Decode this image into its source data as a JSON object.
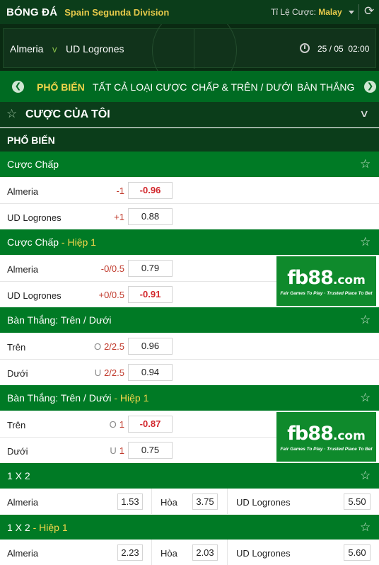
{
  "topbar": {
    "sport": "BÓNG ĐÁ",
    "league": "Spain Segunda Division",
    "odds_type_label": "Tỉ Lệ Cược:",
    "odds_type_value": "Malay",
    "refresh_icon": "refresh-icon"
  },
  "match": {
    "home": "Almeria",
    "vs": "v",
    "away": "UD Logrones",
    "kickoff": "25 / 05  02:00",
    "clock_icon": "clock-icon"
  },
  "tabs": [
    {
      "label": "PHỔ BIẾN",
      "active": true
    },
    {
      "label": "TẤT CẢ LOẠI CƯỢC",
      "active": false
    },
    {
      "label": "CHẤP & TRÊN / DƯỚI",
      "active": false
    },
    {
      "label": "BÀN THẮNG",
      "active": false
    }
  ],
  "my_bets": {
    "title": "CƯỢC CỦA TÔI"
  },
  "popular": {
    "title": "PHỔ BIẾN"
  },
  "markets": {
    "handicap": {
      "name": "Cược Chấp",
      "rows": [
        {
          "team": "Almeria",
          "line": "-1",
          "odd": "-0.96"
        },
        {
          "team": "UD Logrones",
          "line": "+1",
          "odd": "0.88"
        }
      ]
    },
    "handicap_h1": {
      "name": "Cược Chấp",
      "suffix": " - Hiệp 1",
      "rows": [
        {
          "team": "Almeria",
          "line": "-0/0.5",
          "odd": "0.79"
        },
        {
          "team": "UD Logrones",
          "line": "+0/0.5",
          "odd": "-0.91"
        }
      ]
    },
    "ou": {
      "name": "Bàn Thắng: Trên / Dưới",
      "rows": [
        {
          "team": "Trên",
          "ou": "O",
          "line": "2/2.5",
          "odd": "0.96"
        },
        {
          "team": "Dưới",
          "ou": "U",
          "line": "2/2.5",
          "odd": "0.94"
        }
      ]
    },
    "ou_h1": {
      "name": "Bàn Thắng: Trên / Dưới",
      "suffix": " - Hiệp 1",
      "rows": [
        {
          "team": "Trên",
          "ou": "O",
          "line": "1",
          "odd": "-0.87"
        },
        {
          "team": "Dưới",
          "ou": "U",
          "line": "1",
          "odd": "0.75"
        }
      ]
    },
    "x12": {
      "name": "1 X 2",
      "home": "Almeria",
      "home_odd": "1.53",
      "draw": "Hòa",
      "draw_odd": "3.75",
      "away": "UD Logrones",
      "away_odd": "5.50"
    },
    "x12_h1": {
      "name": "1 X 2",
      "suffix": " - Hiệp 1",
      "home": "Almeria",
      "home_odd": "2.23",
      "draw": "Hòa",
      "draw_odd": "2.03",
      "away": "UD Logrones",
      "away_odd": "5.60"
    }
  },
  "ad": {
    "brand": "fb88",
    "domain": ".com",
    "tagline": "Fair Games To Play · Trusted Place To Bet"
  },
  "colors": {
    "header_dark": "#0b3d1a",
    "tab_bar": "#006b22",
    "section": "#007a25",
    "highlight": "#f2d64b",
    "negative_odd": "#d2262b"
  }
}
